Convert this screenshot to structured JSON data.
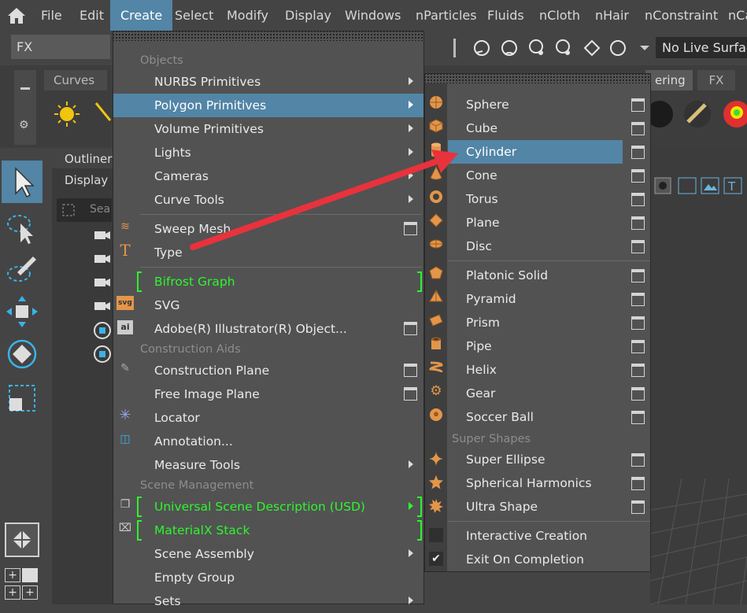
{
  "menubar": {
    "items": [
      "File",
      "Edit",
      "Create",
      "Select",
      "Modify",
      "Display",
      "Windows",
      "nParticles",
      "Fluids",
      "nCloth",
      "nHair",
      "nConstraint",
      "nCa"
    ]
  },
  "statusline": {
    "mode": "FX",
    "live_surface": "No Live Surface"
  },
  "shelf": {
    "tabs": [
      "Curves",
      "ering",
      "FX"
    ]
  },
  "outliner": {
    "title": "Outliner",
    "menu": "Display",
    "search_placeholder": "Sea"
  },
  "create_menu": {
    "sections": {
      "objects": "Objects",
      "construction": "Construction Aids",
      "scene": "Scene Management"
    },
    "items": {
      "nurbs": "NURBS Primitives",
      "polygon": "Polygon Primitives",
      "volume": "Volume Primitives",
      "lights": "Lights",
      "cameras": "Cameras",
      "curve_tools": "Curve Tools",
      "sweep_mesh": "Sweep Mesh",
      "type": "Type",
      "bifrost": "Bifrost Graph",
      "svg": "SVG",
      "illustrator": "Adobe(R) Illustrator(R) Object...",
      "construction_plane": "Construction Plane",
      "free_image_plane": "Free Image Plane",
      "locator": "Locator",
      "annotation": "Annotation...",
      "measure_tools": "Measure Tools",
      "usd": "Universal Scene Description (USD)",
      "materialx": "MaterialX Stack",
      "scene_assembly": "Scene Assembly",
      "empty_group": "Empty Group",
      "sets": "Sets"
    }
  },
  "polygon_menu": {
    "items": {
      "sphere": "Sphere",
      "cube": "Cube",
      "cylinder": "Cylinder",
      "cone": "Cone",
      "torus": "Torus",
      "plane": "Plane",
      "disc": "Disc",
      "platonic": "Platonic Solid",
      "pyramid": "Pyramid",
      "prism": "Prism",
      "pipe": "Pipe",
      "helix": "Helix",
      "gear": "Gear",
      "soccer": "Soccer Ball",
      "super_ellipse": "Super Ellipse",
      "spherical_harmonics": "Spherical Harmonics",
      "ultra_shape": "Ultra Shape",
      "interactive": "Interactive Creation",
      "exit_on_completion": "Exit On Completion"
    },
    "super_shapes_header": "Super Shapes",
    "exit_on_completion_checked": true
  },
  "colors": {
    "highlight": "#5285a6",
    "green": "#2ef52e",
    "annotation_arrow": "#e8323c",
    "icon_orange": "#e3964a"
  }
}
